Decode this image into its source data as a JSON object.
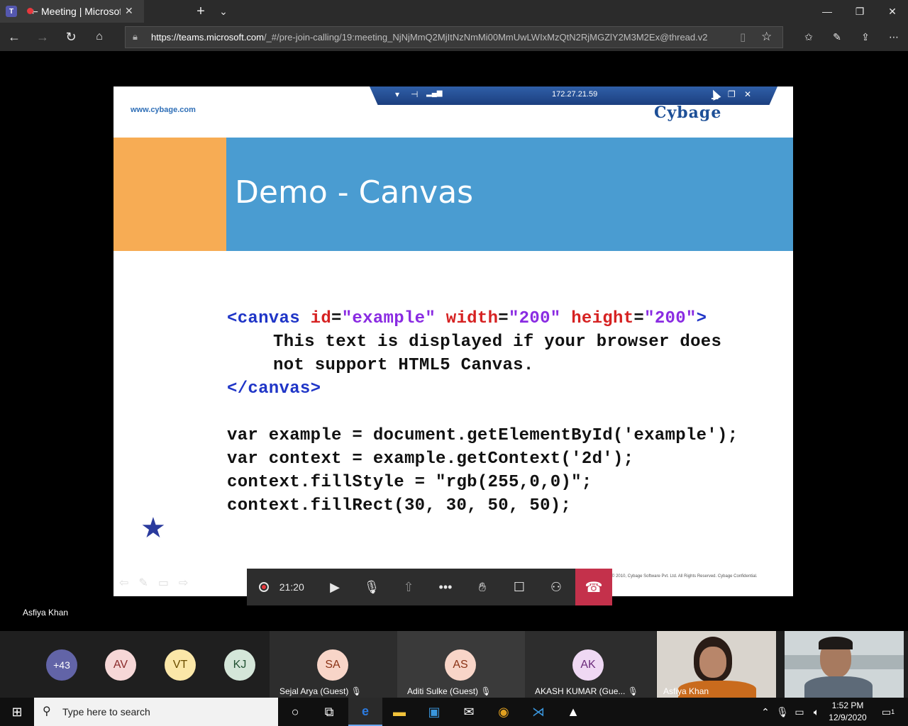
{
  "browser": {
    "tab_title": "Meeting | Microsoft",
    "url_host": "https://teams.microsoft.com",
    "url_path": "/_#/pre-join-calling/19:meeting_NjNjMmQ2MjItNzNmMi00MmUwLWIxMzQtN2RjMGZlY2M3M2Ex@thread.v2"
  },
  "rdp": {
    "ip": "172.27.21.59"
  },
  "slide": {
    "site": "www.cybage.com",
    "logo": "Cybage",
    "title": "Demo - Canvas",
    "html_code": {
      "open_tag": "<canvas",
      "id_attr": "id",
      "id_val": "\"example\"",
      "width_attr": "width",
      "width_val": "\"200\"",
      "height_attr": "height",
      "height_val": "\"200\"",
      "gt": ">",
      "fallback_1": "This text is displayed if your browser does",
      "fallback_2": "not support HTML5 Canvas.",
      "close_tag": "</canvas>"
    },
    "js_code": [
      "var example = document.getElementById('example');",
      "var context = example.getContext('2d');",
      "context.fillStyle = \"rgb(255,0,0)\";",
      "context.fillRect(30, 30, 50, 50);"
    ],
    "copyright": "© 2010, Cybage Software Pvt. Ltd. All Rights Reserved. Cybage Confidential."
  },
  "call": {
    "timer": "21:20",
    "presenter": "Asfiya Khan"
  },
  "participants": {
    "overflow": "+43",
    "avatars": [
      "AV",
      "VT",
      "KJ"
    ],
    "tiles": [
      {
        "initials": "SA",
        "name": "Sejal Arya (Guest)"
      },
      {
        "initials": "AS",
        "name": "Aditi Sulke (Guest)"
      },
      {
        "initials": "AK",
        "name": "AKASH KUMAR (Gue..."
      }
    ],
    "video_name": "Asfiya Khan"
  },
  "taskbar": {
    "search_placeholder": "Type here to search",
    "time": "1:52 PM",
    "date": "12/9/2020",
    "notif_count": "1"
  }
}
